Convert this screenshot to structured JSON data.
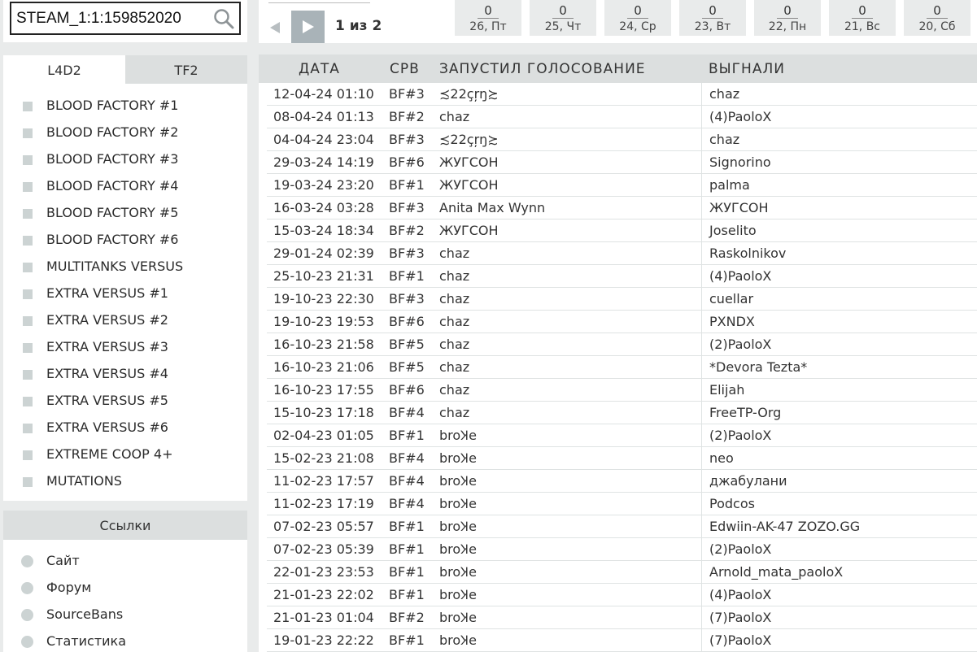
{
  "search": {
    "value": "STEAM_1:1:159852020",
    "icon": "search-icon"
  },
  "tabs": [
    {
      "label": "L4D2",
      "active": true
    },
    {
      "label": "TF2",
      "active": false
    }
  ],
  "servers": [
    "BLOOD FACTORY #1",
    "BLOOD FACTORY #2",
    "BLOOD FACTORY #3",
    "BLOOD FACTORY #4",
    "BLOOD FACTORY #5",
    "BLOOD FACTORY #6",
    "MULTITANKS VERSUS",
    "EXTRA VERSUS #1",
    "EXTRA VERSUS #2",
    "EXTRA VERSUS #3",
    "EXTRA VERSUS #4",
    "EXTRA VERSUS #5",
    "EXTRA VERSUS #6",
    "EXTREME COOP 4+",
    "MUTATIONS"
  ],
  "links": {
    "title": "Ссылки",
    "items": [
      "Сайт",
      "Форум",
      "SourceBans",
      "Статистика"
    ]
  },
  "pager": {
    "info": "1 из 2",
    "days": [
      {
        "count": "0",
        "label": "26, Пт"
      },
      {
        "count": "0",
        "label": "25, Чт"
      },
      {
        "count": "0",
        "label": "24, Ср"
      },
      {
        "count": "0",
        "label": "23, Вт"
      },
      {
        "count": "0",
        "label": "22, Пн"
      },
      {
        "count": "0",
        "label": "21, Вс"
      },
      {
        "count": "0",
        "label": "20, Сб"
      }
    ]
  },
  "table": {
    "headers": {
      "date": "ДАТА",
      "srv": "СРВ",
      "who": "ЗАПУСТИЛ ГОЛОСОВАНИЕ",
      "kicked": "ВЫГНАЛИ"
    },
    "rows": [
      [
        "12-04-24 01:10",
        "BF#3",
        "≾22çŗŋ≿",
        "chaz"
      ],
      [
        "08-04-24 01:13",
        "BF#2",
        "chaz",
        "(4)PaoloX"
      ],
      [
        "04-04-24 23:04",
        "BF#3",
        "≾22çŗŋ≿",
        "chaz"
      ],
      [
        "29-03-24 14:19",
        "BF#6",
        "ЖУГСОН",
        "Signorino"
      ],
      [
        "19-03-24 23:20",
        "BF#1",
        "ЖУГСОН",
        "palma"
      ],
      [
        "16-03-24 03:28",
        "BF#3",
        "Anita Max Wynn",
        "ЖУГСОН"
      ],
      [
        "15-03-24 18:34",
        "BF#2",
        "ЖУГСОН",
        "Joselito"
      ],
      [
        "29-01-24 02:39",
        "BF#3",
        "chaz",
        "Raskolnikov"
      ],
      [
        "25-10-23 21:31",
        "BF#1",
        "chaz",
        "(4)PaoloX"
      ],
      [
        "19-10-23 22:30",
        "BF#3",
        "chaz",
        "cuellar"
      ],
      [
        "19-10-23 19:53",
        "BF#6",
        "chaz",
        "PXNDX"
      ],
      [
        "16-10-23 21:58",
        "BF#5",
        "chaz",
        "(2)PaoloX"
      ],
      [
        "16-10-23 21:06",
        "BF#5",
        "chaz",
        "*Devora Tezta*"
      ],
      [
        "16-10-23 17:55",
        "BF#6",
        "chaz",
        "Elijah"
      ],
      [
        "15-10-23 17:18",
        "BF#4",
        "chaz",
        "FreeTP-Org"
      ],
      [
        "02-04-23 01:05",
        "BF#1",
        "broꞰe",
        "(2)PaoloX"
      ],
      [
        "15-02-23 21:08",
        "BF#4",
        "broꞰe",
        "neo"
      ],
      [
        "11-02-23 17:57",
        "BF#4",
        "broꞰe",
        "джабулани"
      ],
      [
        "11-02-23 17:19",
        "BF#4",
        "broꞰe",
        "Podcos"
      ],
      [
        "07-02-23 05:57",
        "BF#1",
        "broꞰe",
        "Edwiin-AK-47 ZOZO.GG"
      ],
      [
        "07-02-23 05:39",
        "BF#1",
        "broꞰe",
        "(2)PaoloX"
      ],
      [
        "22-01-23 23:53",
        "BF#1",
        "broꞰe",
        "Arnold_mata_paoloX"
      ],
      [
        "21-01-23 22:02",
        "BF#1",
        "broꞰe",
        "(4)PaoloX"
      ],
      [
        "21-01-23 01:04",
        "BF#2",
        "broꞰe",
        "(7)PaoloX"
      ],
      [
        "19-01-23 22:22",
        "BF#1",
        "broꞰe",
        "(7)PaoloX"
      ]
    ]
  }
}
